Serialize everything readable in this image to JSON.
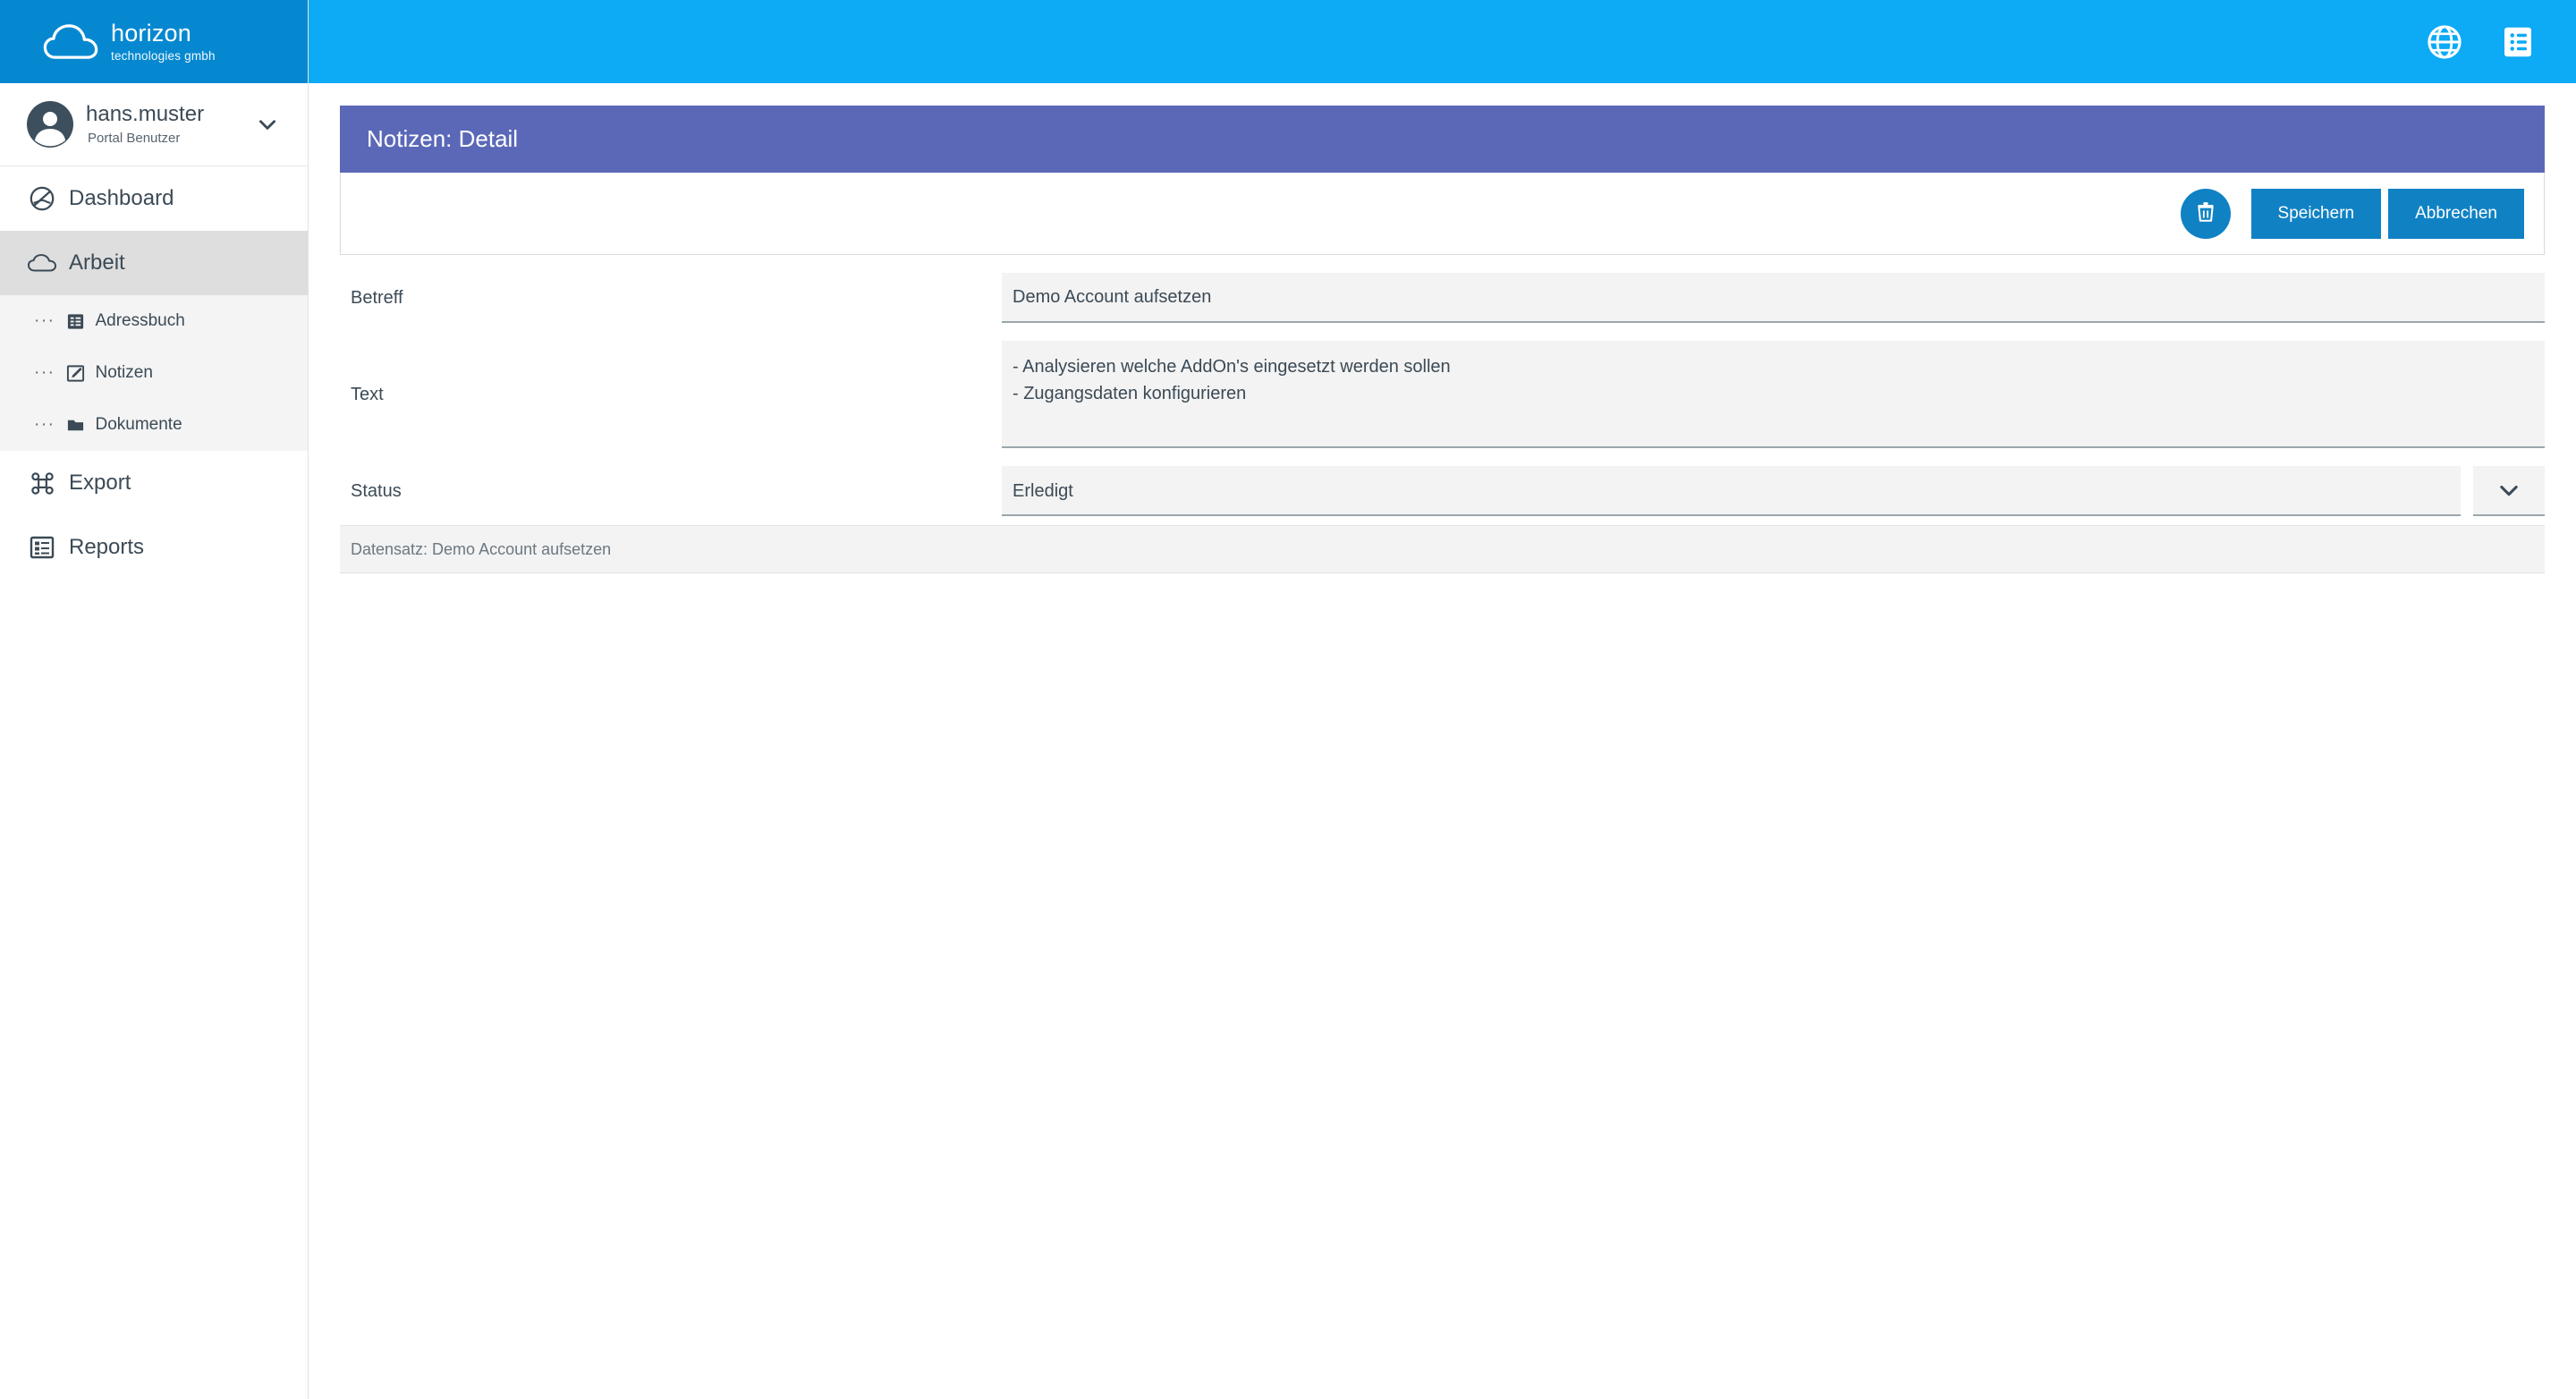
{
  "brand": {
    "name": "horizon",
    "tagline": "technologies gmbh",
    "logo_icon": "cloud-icon",
    "logo_bg": "#0588d0",
    "header_bg": "#0daaf5"
  },
  "user": {
    "name": "hans.muster",
    "role": "Portal Benutzer",
    "avatar_icon": "user-avatar-icon",
    "caret_icon": "chevron-down-icon"
  },
  "header": {
    "icons": [
      {
        "name": "globe-icon",
        "label": "Sprache"
      },
      {
        "name": "list-document-icon",
        "label": "Protokoll"
      }
    ]
  },
  "sidebar": {
    "items": [
      {
        "label": "Dashboard",
        "icon": "cloud-slash-icon",
        "active": false
      },
      {
        "label": "Arbeit",
        "icon": "cloud-outline-icon",
        "active": true
      },
      {
        "label": "Export",
        "icon": "command-icon",
        "active": false
      },
      {
        "label": "Reports",
        "icon": "table-grid-icon",
        "active": false
      }
    ],
    "subitems": [
      {
        "label": "Adressbuch",
        "icon": "list-icon",
        "dots": "···"
      },
      {
        "label": "Notizen",
        "icon": "edit-square-icon",
        "dots": "···"
      },
      {
        "label": "Dokumente",
        "icon": "folder-icon",
        "dots": "···"
      }
    ]
  },
  "panel": {
    "title": "Notizen: Detail",
    "title_bg": "#5b68b8",
    "toolbar": {
      "delete_icon": "trash-icon",
      "save_label": "Speichern",
      "cancel_label": "Abbrechen",
      "button_color": "#1082c4"
    },
    "fields": [
      {
        "label": "Betreff",
        "type": "text",
        "value": "Demo Account aufsetzen",
        "placeholder": ""
      },
      {
        "label": "Text",
        "type": "textarea",
        "value": "- Analysieren welche AddOn's eingesetzt werden sollen\n- Zugangsdaten konfigurieren",
        "placeholder": ""
      },
      {
        "label": "Status",
        "type": "select",
        "value": "Erledigt",
        "caret_icon": "chevron-down-icon"
      }
    ],
    "footer": "Datensatz: Demo Account aufsetzen"
  }
}
